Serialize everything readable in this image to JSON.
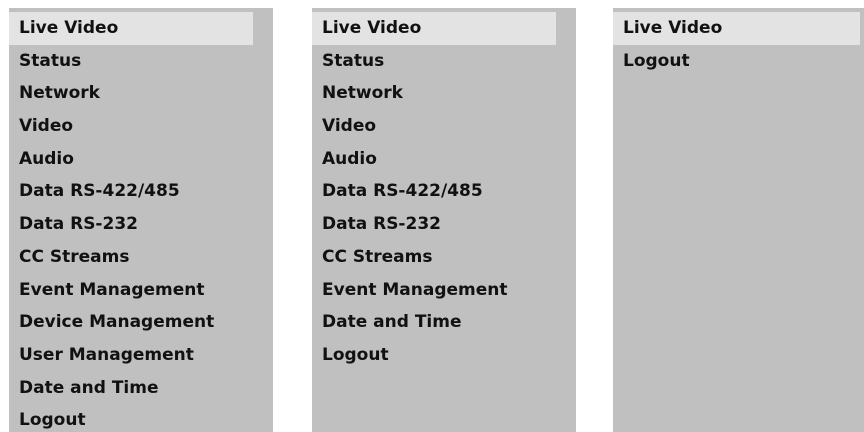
{
  "panels": [
    {
      "items": [
        "Live Video",
        "Status",
        "Network",
        "Video",
        "Audio",
        "Data RS-422/485",
        "Data RS-232",
        "CC Streams",
        "Event Management",
        "Device Management",
        "User Management",
        "Date and Time",
        "Logout"
      ]
    },
    {
      "items": [
        "Live Video",
        "Status",
        "Network",
        "Video",
        "Audio",
        "Data RS-422/485",
        "Data RS-232",
        "CC Streams",
        "Event Management",
        "Date and Time",
        "Logout"
      ]
    },
    {
      "items": [
        "Live Video",
        "Logout"
      ]
    }
  ],
  "colors": {
    "panel_background": "#c0c0c0",
    "active_item_background": "#e3e3e3",
    "text": "#111111"
  }
}
